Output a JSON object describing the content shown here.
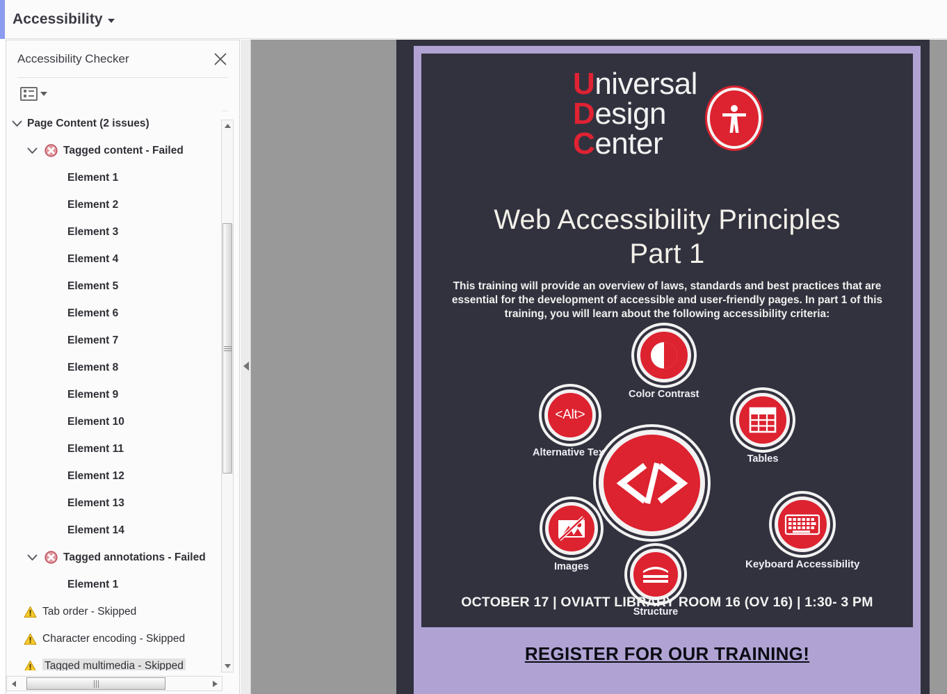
{
  "menubar": {
    "items": [
      {
        "label": "Accessibility",
        "has_caret": true
      }
    ]
  },
  "panel": {
    "title": "Accessibility Checker",
    "close_icon": "close-icon",
    "toolbar": {
      "options_icon": "list-options-icon",
      "caret_icon": "chevron-down-icon"
    },
    "tree": [
      {
        "label": "Page Content (2 issues)",
        "indent": 0,
        "chevron": "expanded",
        "bold": true,
        "status": null
      },
      {
        "label": "Tagged content - Failed",
        "indent": 1,
        "chevron": "expanded",
        "bold": true,
        "status": "failed"
      },
      {
        "label": "Element 1",
        "indent": 3,
        "chevron": null,
        "bold": true,
        "status": null
      },
      {
        "label": "Element 2",
        "indent": 3,
        "chevron": null,
        "bold": true,
        "status": null
      },
      {
        "label": "Element 3",
        "indent": 3,
        "chevron": null,
        "bold": true,
        "status": null
      },
      {
        "label": "Element 4",
        "indent": 3,
        "chevron": null,
        "bold": true,
        "status": null
      },
      {
        "label": "Element 5",
        "indent": 3,
        "chevron": null,
        "bold": true,
        "status": null
      },
      {
        "label": "Element 6",
        "indent": 3,
        "chevron": null,
        "bold": true,
        "status": null
      },
      {
        "label": "Element 7",
        "indent": 3,
        "chevron": null,
        "bold": true,
        "status": null
      },
      {
        "label": "Element 8",
        "indent": 3,
        "chevron": null,
        "bold": true,
        "status": null
      },
      {
        "label": "Element 9",
        "indent": 3,
        "chevron": null,
        "bold": true,
        "status": null
      },
      {
        "label": "Element 10",
        "indent": 3,
        "chevron": null,
        "bold": true,
        "status": null
      },
      {
        "label": "Element 11",
        "indent": 3,
        "chevron": null,
        "bold": true,
        "status": null
      },
      {
        "label": "Element 12",
        "indent": 3,
        "chevron": null,
        "bold": true,
        "status": null
      },
      {
        "label": "Element 13",
        "indent": 3,
        "chevron": null,
        "bold": true,
        "status": null
      },
      {
        "label": "Element 14",
        "indent": 3,
        "chevron": null,
        "bold": true,
        "status": null
      },
      {
        "label": "Tagged annotations - Failed",
        "indent": 1,
        "chevron": "expanded",
        "bold": true,
        "status": "failed"
      },
      {
        "label": "Element 1",
        "indent": 3,
        "chevron": null,
        "bold": true,
        "status": null
      },
      {
        "label": "Tab order - Skipped",
        "indent": 1,
        "chevron": null,
        "bold": false,
        "status": "skipped"
      },
      {
        "label": "Character encoding - Skipped",
        "indent": 1,
        "chevron": null,
        "bold": false,
        "status": "skipped"
      },
      {
        "label": "Tagged multimedia - Skipped",
        "indent": 1,
        "chevron": null,
        "bold": false,
        "status": "skipped",
        "selected": true
      }
    ],
    "vscrollbar": {
      "up_icon": "scroll-up-arrow-icon",
      "down_icon": "scroll-down-arrow-icon"
    },
    "hscrollbar": {
      "left_icon": "scroll-left-arrow-icon",
      "right_icon": "scroll-right-arrow-icon"
    }
  },
  "splitter": {
    "collapse_icon": "collapse-panel-arrow-icon"
  },
  "document": {
    "logo": {
      "lines": [
        {
          "initial": "U",
          "rest": "niversal"
        },
        {
          "initial": "D",
          "rest": "esign"
        },
        {
          "initial": "C",
          "rest": "enter"
        }
      ],
      "badge_icon": "accessibility-person-icon"
    },
    "title_line1": "Web Accessibility Principles",
    "title_line2": "Part 1",
    "paragraph": "This training will provide an overview of laws, standards and best practices that are essential for the development of accessible and user-friendly pages. In part 1 of this training, you will learn about the following accessibility criteria:",
    "icons": [
      {
        "label": "Color Contrast",
        "icon": "color-contrast-icon"
      },
      {
        "label": "Alternative Text",
        "icon": "alt-text-icon",
        "text": "<Alt>"
      },
      {
        "label": "Tables",
        "icon": "table-icon"
      },
      {
        "label": "",
        "icon": "code-brackets-icon"
      },
      {
        "label": "Images",
        "icon": "broken-image-icon"
      },
      {
        "label": "Keyboard Accessibility",
        "icon": "keyboard-icon"
      },
      {
        "label": "Structure",
        "icon": "document-structure-icon"
      }
    ],
    "event_line": "OCTOBER 17 | OVIATT LIBRARY ROOM 16 (OV 16) | 1:30- 3 PM",
    "register_cta": "REGISTER FOR OUR TRAINING!"
  },
  "colors": {
    "brand_red": "#dd2230",
    "page_dark": "#32323f",
    "page_purple": "#b0a3d4",
    "viewer_gray": "#999999",
    "menu_accent": "#8b9bf0",
    "failed_red": "#d06a6e",
    "warning_yellow": "#f5c21b"
  }
}
